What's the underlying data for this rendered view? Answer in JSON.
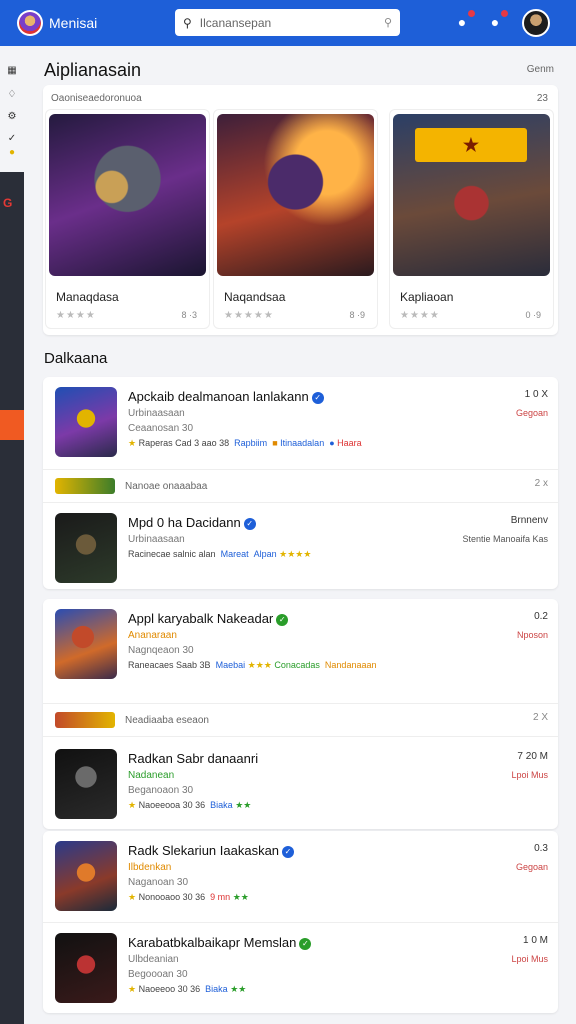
{
  "app": {
    "title": "Menisai"
  },
  "search": {
    "placeholder": "Ilcanansepan"
  },
  "rail": {
    "red_label": "G"
  },
  "featured": {
    "title": "Aiplianasain",
    "link": "Genm",
    "header": "Oaoniseaedoronuoa",
    "count": "23",
    "tiles": [
      {
        "name": "Manaqdasa",
        "meta": "8 ·3",
        "rating": 0
      },
      {
        "name": "Naqandsaa",
        "meta": "8 ·9",
        "rating": 0
      },
      {
        "name": "Kapliaoan",
        "meta": "0 ·9",
        "rating": 0
      }
    ]
  },
  "list": {
    "title": "Dalkaana",
    "rows": [
      {
        "title": "Apckaib dealmanoan lanlakann",
        "sub": "Urbinaasaan",
        "sub2": "Ceaanosan 30",
        "tags": "Raperas Cad 3 aao 38",
        "tag_a": "Rapbiim",
        "tag_b": "Itinaadalan",
        "tag_c": "Haara",
        "price": "1 0 X",
        "note": "Gegoan"
      },
      {
        "title": "Mpd 0 ha Dacidann",
        "sub": "Urbinaasaan",
        "sub2": "",
        "tags": "Racinecae salnic alan",
        "tag_a": "Mareat",
        "tag_b": "Alpan",
        "tag_c": "",
        "price": "Brnnenv",
        "note": "Stentie Manoaifa Kas"
      },
      {
        "title": "Appl karyabalk Nakeadar",
        "sub": "Ananaraan",
        "sub2": "Nagnqeaon 30",
        "tags": "Raneacaes Saab 3B",
        "tag_a": "Maebai",
        "tag_b": "Conacadas",
        "tag_c": "Nandanaaan",
        "price": "0.2",
        "note": "Nposon"
      },
      {
        "title": "Radkan Sabr danaanri",
        "sub": "Nadanean",
        "sub2": "Beganoaon 30",
        "tags": "Naoeeooa 30 36",
        "tag_a": "Biaka",
        "tag_b": "",
        "tag_c": "",
        "price": "7 20 M",
        "note": "Lpoi Mus"
      },
      {
        "title": "Radk Slekariun Iaakaskan",
        "sub": "Ilbdenkan",
        "sub2": "Naganoan 30",
        "tags": "Nonooaoo 30 36",
        "tag_a": "9 mn",
        "tag_b": "",
        "tag_c": "",
        "price": "0.3",
        "note": "Gegoan"
      },
      {
        "title": "Karabatbkalbaikapr Memslan",
        "sub": "Ulbdeanian",
        "sub2": "Begoooan 30",
        "tags": "Naoeeoo 30 36",
        "tag_a": "Biaka",
        "tag_b": "",
        "tag_c": "",
        "price": "1 0 M",
        "note": "Lpoi Mus"
      }
    ],
    "subheads": [
      {
        "text": "Nanoae onaaabaa",
        "count": "2 x"
      },
      {
        "text": "Neadiaaba eseaon",
        "count": "2 X"
      }
    ]
  }
}
